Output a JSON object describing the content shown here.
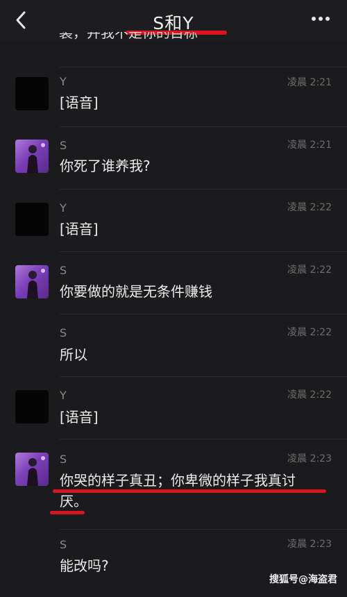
{
  "header": {
    "title": "S和Y",
    "back_icon": "chevron-left-icon",
    "more_icon": "more-dots-icon"
  },
  "partial_top_text": "装，并我不是你的目标",
  "messages": [
    {
      "sender": "Y",
      "time": "凌晨 2:21",
      "text": "[语音]",
      "avatar": "dark"
    },
    {
      "sender": "S",
      "time": "凌晨 2:21",
      "text": "你死了谁养我?",
      "avatar": "girl"
    },
    {
      "sender": "Y",
      "time": "凌晨 2:22",
      "text": "[语音]",
      "avatar": "dark"
    },
    {
      "sender": "S",
      "time": "凌晨 2:22",
      "text": "你要做的就是无条件赚钱",
      "avatar": "girl"
    },
    {
      "sender": "S",
      "time": "凌晨 2:22",
      "text": "所以",
      "avatar": "none"
    },
    {
      "sender": "Y",
      "time": "凌晨 2:22",
      "text": "[语音]",
      "avatar": "dark"
    },
    {
      "sender": "S",
      "time": "凌晨 2:23",
      "text_line1": "你哭的样子真丑；你卑微的样子我真讨",
      "text_line2": "厌。",
      "avatar": "girl"
    },
    {
      "sender": "S",
      "time": "凌晨 2:23",
      "text": "能改吗?",
      "avatar": "none"
    }
  ],
  "watermark": "搜狐号@海盗君",
  "colors": {
    "background": "#1b1a1c",
    "highlight": "#d8151e",
    "avatar_girl": "#7a3fb8"
  }
}
